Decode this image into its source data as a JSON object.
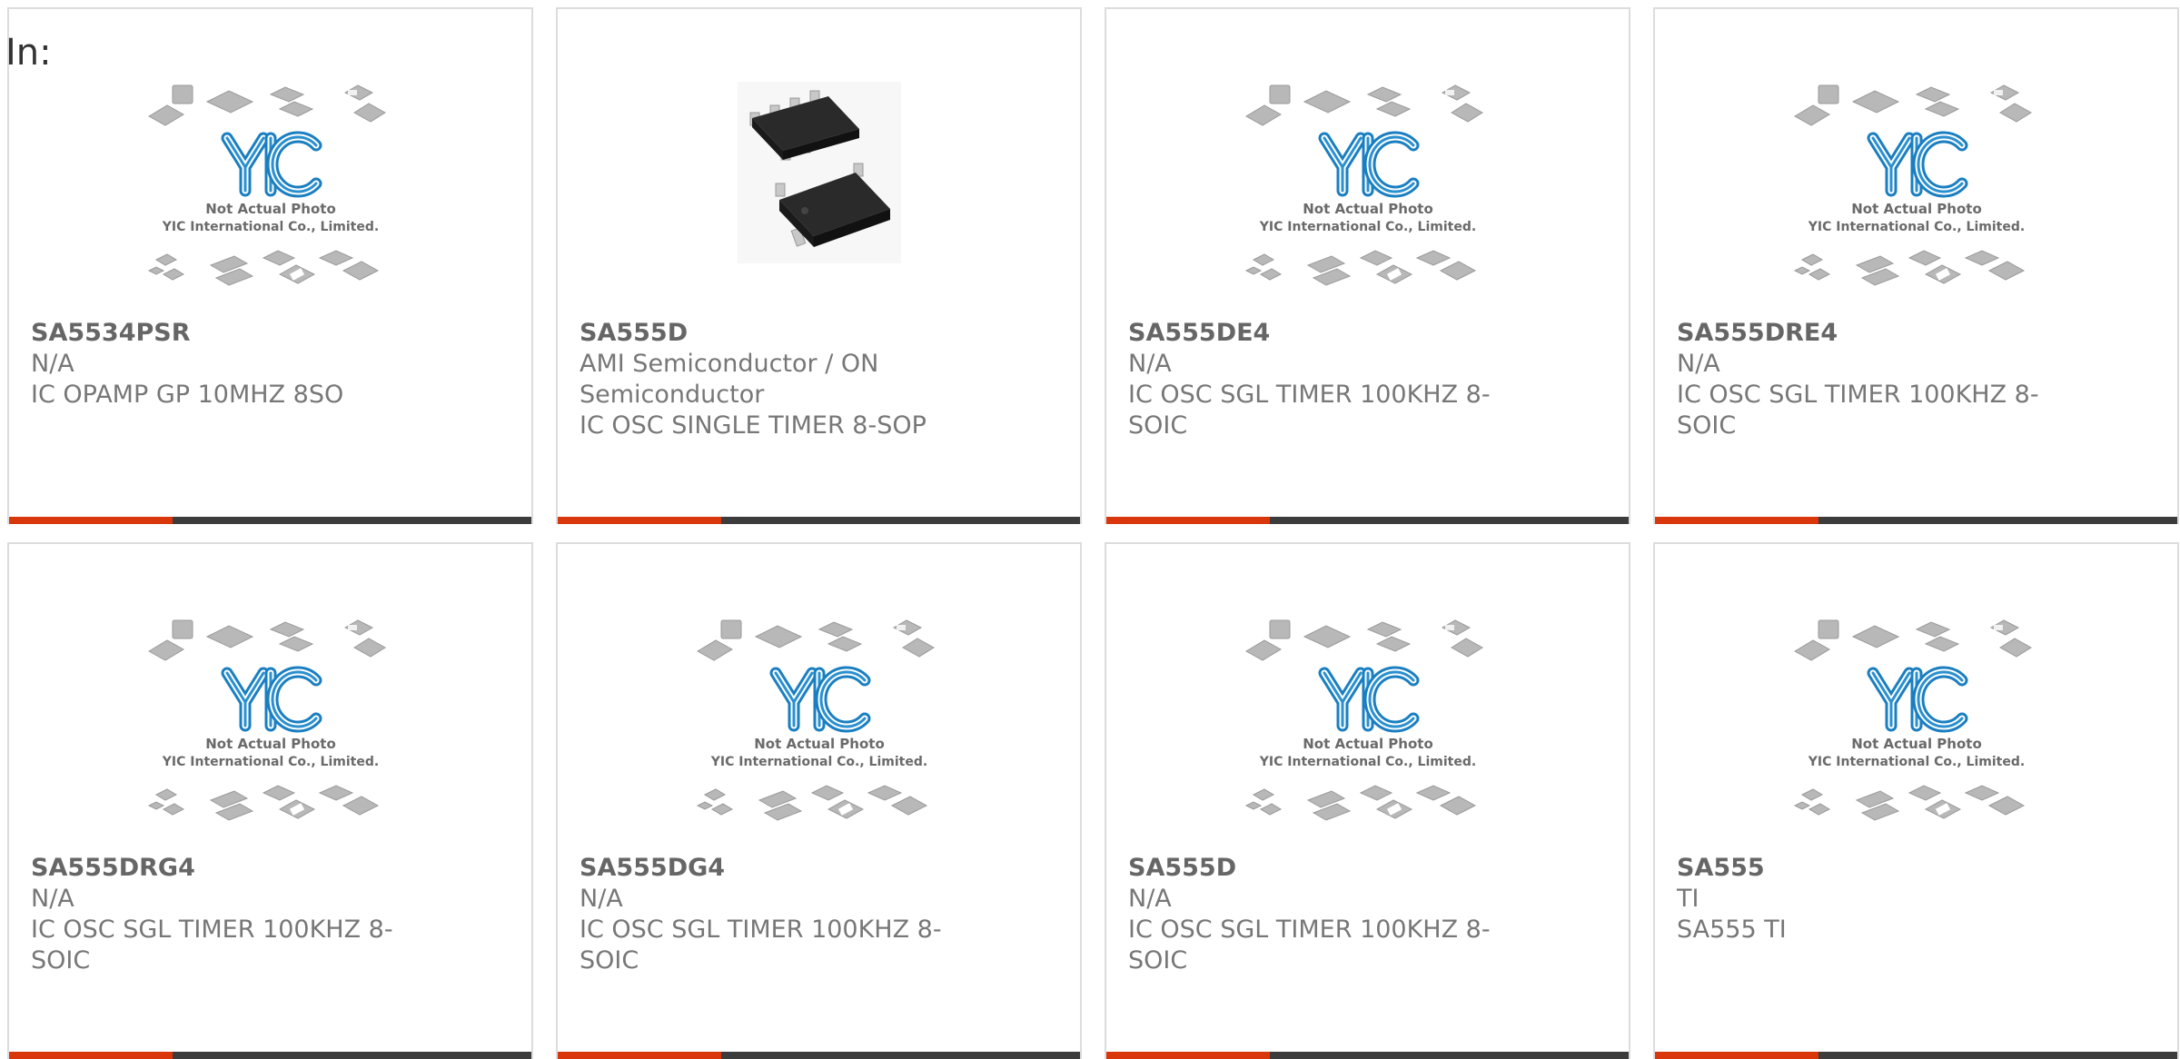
{
  "header": {
    "in_label": "In:"
  },
  "placeholder": {
    "line1": "Not Actual Photo",
    "line2": "YIC International Co., Limited."
  },
  "colors": {
    "accent": "#d9360b",
    "bar": "#3c3c3c",
    "logo_blue": "#1a7fc1",
    "chip_gray": "#b8b8b8"
  },
  "products": [
    {
      "part": "SA5534PSR",
      "manufacturer": "N/A",
      "description": "IC OPAMP GP 10MHZ 8SO",
      "image": "placeholder-icon"
    },
    {
      "part": "SA555D",
      "manufacturer": "AMI Semiconductor / ON Semiconductor",
      "description": "IC OSC SINGLE TIMER 8-SOP",
      "image": "soic8-chip-icon"
    },
    {
      "part": "SA555DE4",
      "manufacturer": "N/A",
      "description": "IC OSC SGL TIMER 100KHZ 8-SOIC",
      "image": "placeholder-icon"
    },
    {
      "part": "SA555DRE4",
      "manufacturer": "N/A",
      "description": "IC OSC SGL TIMER 100KHZ 8-SOIC",
      "image": "placeholder-icon"
    },
    {
      "part": "SA555DRG4",
      "manufacturer": "N/A",
      "description": "IC OSC SGL TIMER 100KHZ 8-SOIC",
      "image": "placeholder-icon"
    },
    {
      "part": "SA555DG4",
      "manufacturer": "N/A",
      "description": "IC OSC SGL TIMER 100KHZ 8-SOIC",
      "image": "placeholder-icon"
    },
    {
      "part": "SA555D",
      "manufacturer": "N/A",
      "description": "IC OSC SGL TIMER 100KHZ 8-SOIC",
      "image": "placeholder-icon"
    },
    {
      "part": "SA555",
      "manufacturer": "TI",
      "description": "SA555 TI",
      "image": "placeholder-icon"
    }
  ]
}
